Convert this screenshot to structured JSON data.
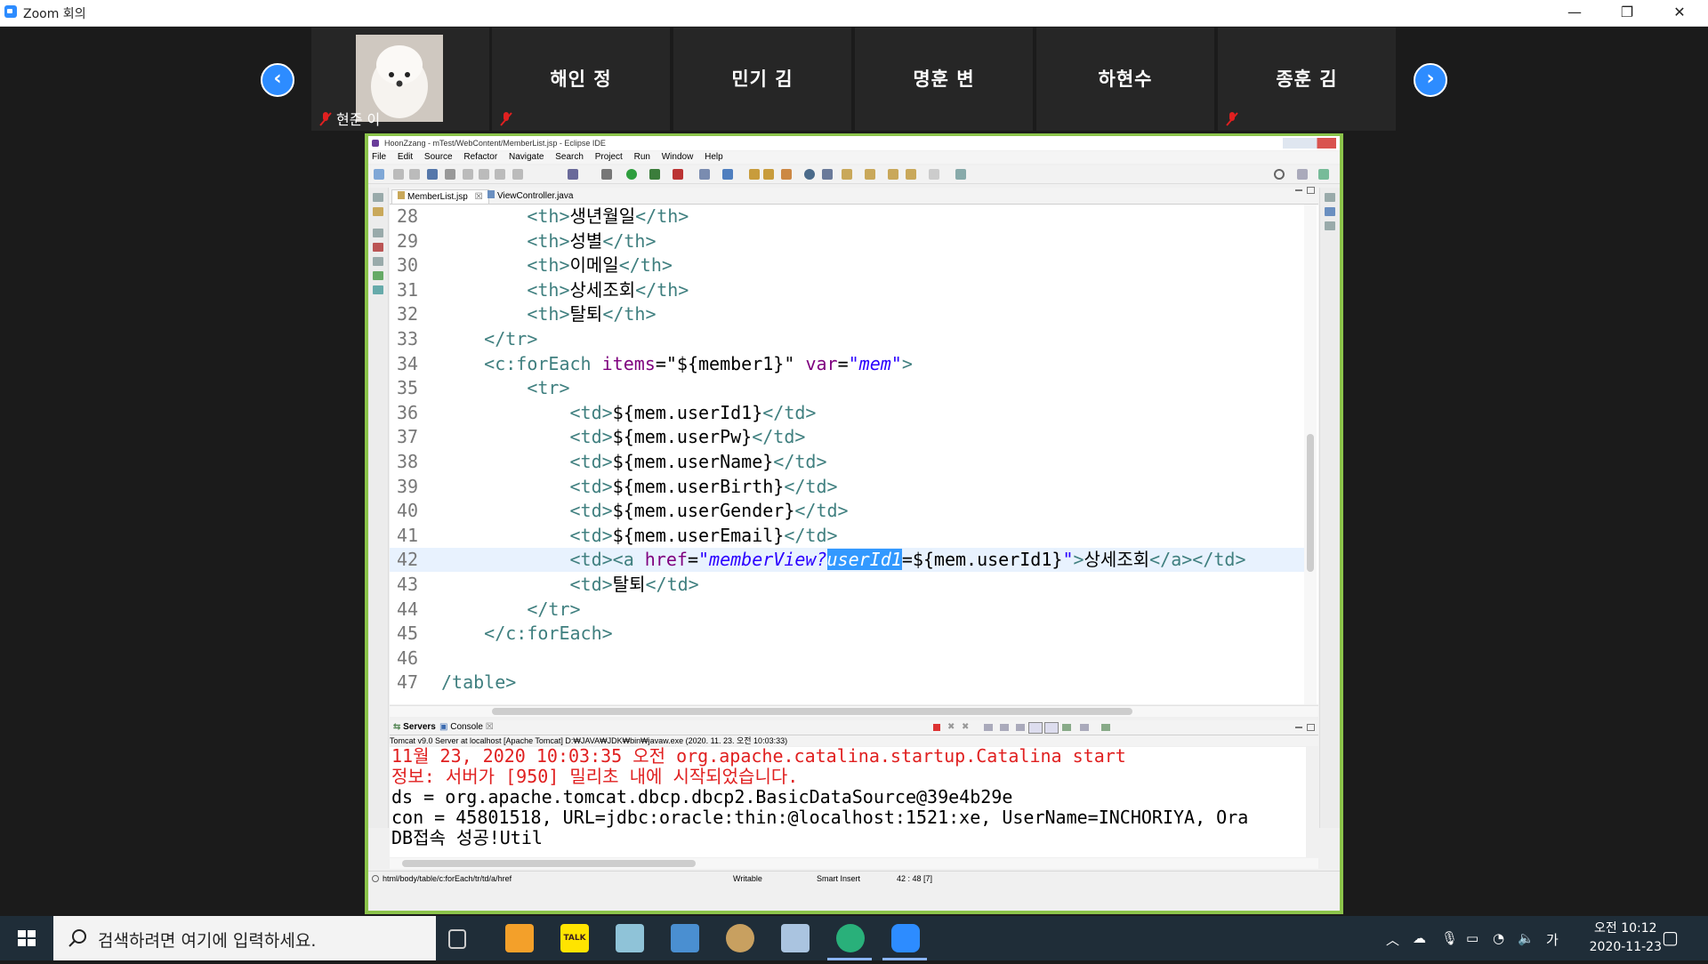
{
  "zoom": {
    "window_title": "Zoom 회의",
    "controls": {
      "minimize": "—",
      "restore": "❐",
      "close": "✕"
    },
    "participants": [
      {
        "name": "현준 이",
        "has_video": true,
        "muted": true
      },
      {
        "name": "해인 정",
        "has_video": false,
        "muted": true
      },
      {
        "name": "민기 김",
        "has_video": false,
        "muted": false
      },
      {
        "name": "명훈 변",
        "has_video": false,
        "muted": false
      },
      {
        "name": "하현수",
        "has_video": false,
        "muted": false
      },
      {
        "name": "종훈 김",
        "has_video": false,
        "muted": true
      }
    ],
    "prev_label": "‹",
    "next_label": "›"
  },
  "eclipse": {
    "title": "HoonZzang - mTest/WebContent/MemberList.jsp - Eclipse IDE",
    "menu": [
      "File",
      "Edit",
      "Source",
      "Refactor",
      "Navigate",
      "Search",
      "Project",
      "Run",
      "Window",
      "Help"
    ],
    "tabs": [
      {
        "label": "MemberList.jsp",
        "close": "☒",
        "active": true
      },
      {
        "label": "ViewController.java",
        "active": false
      }
    ],
    "code_lines": [
      {
        "num": "28",
        "indent": "        ",
        "parts": [
          [
            "tag",
            "<th>"
          ],
          [
            "txt",
            "생년월일"
          ],
          [
            "tag",
            "</th>"
          ]
        ]
      },
      {
        "num": "29",
        "indent": "        ",
        "parts": [
          [
            "tag",
            "<th>"
          ],
          [
            "txt",
            "성별"
          ],
          [
            "tag",
            "</th>"
          ]
        ]
      },
      {
        "num": "30",
        "indent": "        ",
        "parts": [
          [
            "tag",
            "<th>"
          ],
          [
            "txt",
            "이메일"
          ],
          [
            "tag",
            "</th>"
          ]
        ]
      },
      {
        "num": "31",
        "indent": "        ",
        "parts": [
          [
            "tag",
            "<th>"
          ],
          [
            "txt",
            "상세조회"
          ],
          [
            "tag",
            "</th>"
          ]
        ]
      },
      {
        "num": "32",
        "indent": "        ",
        "parts": [
          [
            "tag",
            "<th>"
          ],
          [
            "txt",
            "탈퇴"
          ],
          [
            "tag",
            "</th>"
          ]
        ]
      },
      {
        "num": "33",
        "indent": "    ",
        "parts": [
          [
            "tag",
            "</tr>"
          ]
        ]
      },
      {
        "num": "34",
        "indent": "    ",
        "parts": [
          [
            "tag",
            "<c:forEach "
          ],
          [
            "attr",
            "items"
          ],
          [
            "txt",
            "="
          ],
          [
            "txt",
            "\"${member1}\""
          ],
          [
            "txt",
            " "
          ],
          [
            "attr",
            "var"
          ],
          [
            "txt",
            "="
          ],
          [
            "val",
            "\"mem\""
          ],
          [
            "tag",
            ">"
          ]
        ]
      },
      {
        "num": "35",
        "indent": "        ",
        "parts": [
          [
            "tag",
            "<tr>"
          ]
        ]
      },
      {
        "num": "36",
        "indent": "            ",
        "parts": [
          [
            "tag",
            "<td>"
          ],
          [
            "txt",
            "${mem.userId1}"
          ],
          [
            "tag",
            "</td>"
          ]
        ]
      },
      {
        "num": "37",
        "indent": "            ",
        "parts": [
          [
            "tag",
            "<td>"
          ],
          [
            "txt",
            "${mem.userPw}"
          ],
          [
            "tag",
            "</td>"
          ]
        ]
      },
      {
        "num": "38",
        "indent": "            ",
        "parts": [
          [
            "tag",
            "<td>"
          ],
          [
            "txt",
            "${mem.userName}"
          ],
          [
            "tag",
            "</td>"
          ]
        ]
      },
      {
        "num": "39",
        "indent": "            ",
        "parts": [
          [
            "tag",
            "<td>"
          ],
          [
            "txt",
            "${mem.userBirth}"
          ],
          [
            "tag",
            "</td>"
          ]
        ]
      },
      {
        "num": "40",
        "indent": "            ",
        "parts": [
          [
            "tag",
            "<td>"
          ],
          [
            "txt",
            "${mem.userGender}"
          ],
          [
            "tag",
            "</td>"
          ]
        ]
      },
      {
        "num": "41",
        "indent": "            ",
        "parts": [
          [
            "tag",
            "<td>"
          ],
          [
            "txt",
            "${mem.userEmail}"
          ],
          [
            "tag",
            "</td>"
          ]
        ]
      },
      {
        "num": "42",
        "indent": "            ",
        "parts": [
          [
            "tag",
            "<td><a "
          ],
          [
            "attr",
            "href"
          ],
          [
            "txt",
            "="
          ],
          [
            "val",
            "\"memberView?"
          ],
          [
            "sel",
            "userId1"
          ],
          [
            "txt",
            "=${mem.userId1}"
          ],
          [
            "val",
            "\""
          ],
          [
            "tag",
            ">"
          ],
          [
            "txt",
            "상세조회"
          ],
          [
            "tag",
            "</a></td>"
          ]
        ]
      },
      {
        "num": "43",
        "indent": "            ",
        "parts": [
          [
            "tag",
            "<td>"
          ],
          [
            "txt",
            "탈퇴"
          ],
          [
            "tag",
            "</td>"
          ]
        ]
      },
      {
        "num": "44",
        "indent": "        ",
        "parts": [
          [
            "tag",
            "</tr>"
          ]
        ]
      },
      {
        "num": "45",
        "indent": "    ",
        "parts": [
          [
            "tag",
            "</c:forEach>"
          ]
        ]
      },
      {
        "num": "46",
        "indent": "",
        "parts": []
      },
      {
        "num": "47",
        "indent": "",
        "parts": [
          [
            "tag",
            "/table>"
          ]
        ]
      }
    ],
    "console_tabs": [
      "Servers",
      "Console"
    ],
    "console_desc": "Tomcat v9.0 Server at localhost [Apache Tomcat] D:₩JAVA₩JDK₩bin₩javaw.exe  (2020. 11. 23. 오전 10:03:33)",
    "console_lines": [
      {
        "text": "11월 23, 2020 10:03:35 오전 org.apache.catalina.startup.Catalina start",
        "color": "#e02020"
      },
      {
        "text": "정보: 서버가 [950] 밀리초 내에 시작되었습니다.",
        "color": "#e02020"
      },
      {
        "text": "ds = org.apache.tomcat.dbcp.dbcp2.BasicDataSource@39e4b29e",
        "color": "#000000"
      },
      {
        "text": "con = 45801518, URL=jdbc:oracle:thin:@localhost:1521:xe, UserName=INCHORIYA, Ora",
        "color": "#000000"
      },
      {
        "text": "DB접속 성공!Util",
        "color": "#000000"
      }
    ],
    "status": {
      "path": "html/body/table/c:forEach/tr/td/a/href",
      "writable": "Writable",
      "insert_mode": "Smart Insert",
      "position": "42 : 48 [7]"
    }
  },
  "taskbar": {
    "search_placeholder": "검색하려면 여기에 입력하세요.",
    "time": "오전 10:12",
    "date": "2020-11-23",
    "ime": "가"
  }
}
